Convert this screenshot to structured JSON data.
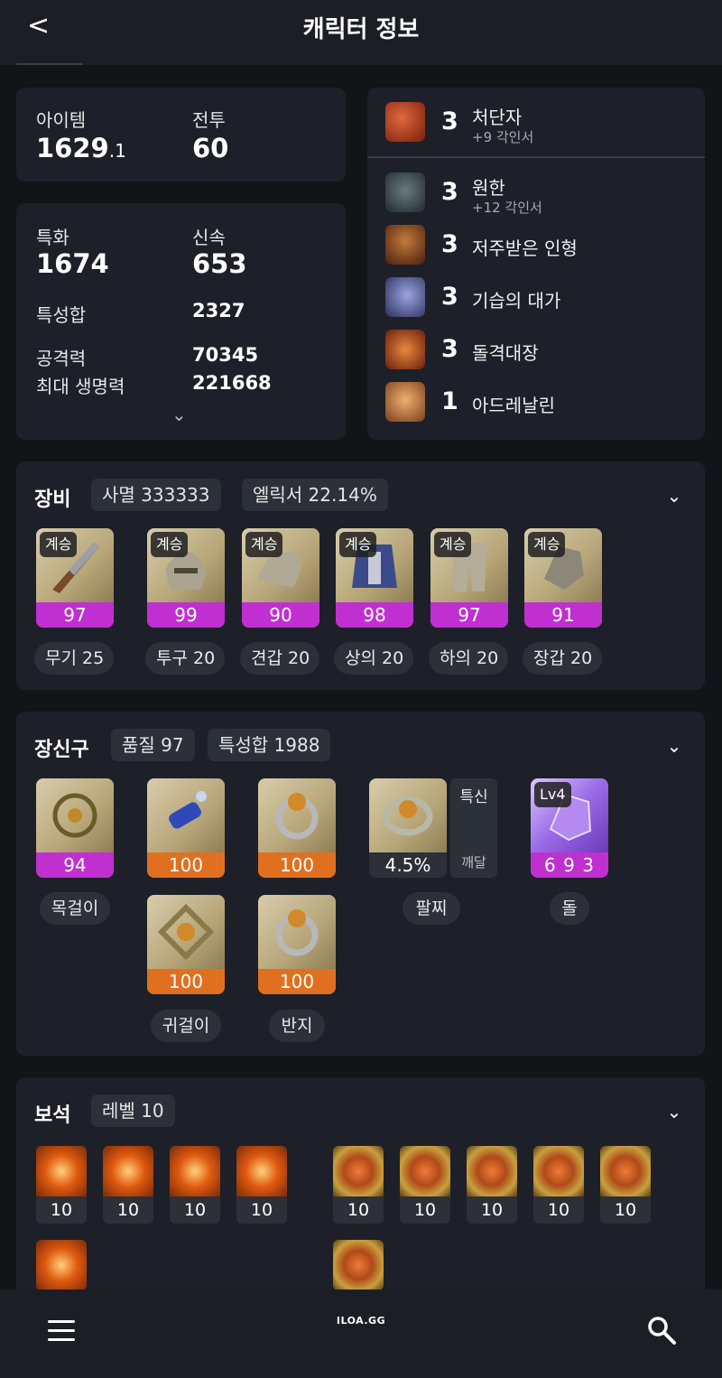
{
  "header": {
    "back": "<",
    "title": "캐릭터 정보"
  },
  "stats_top": {
    "item_label": "아이템",
    "item_value": "1629",
    "item_decimal": ".1",
    "combat_label": "전투",
    "combat_value": "60"
  },
  "stats": {
    "spec_label": "특화",
    "spec_value": "1674",
    "swift_label": "신속",
    "swift_value": "653",
    "total_label": "특성합",
    "total_value": "2327",
    "atk_label": "공격력",
    "atk_value": "70345",
    "hp_label": "최대 생명력",
    "hp_value": "221668",
    "expand": "⌄"
  },
  "engravings": [
    {
      "level": "3",
      "name": "처단자",
      "sub": "+9 각인서",
      "icon_color": "#b83a1c"
    },
    {
      "level": "3",
      "name": "원한",
      "sub": "+12 각인서",
      "icon_color": "#3a4d4f"
    },
    {
      "level": "3",
      "name": "저주받은 인형",
      "sub": "",
      "icon_color": "#8a4a1a"
    },
    {
      "level": "3",
      "name": "기습의 대가",
      "sub": "",
      "icon_color": "#3b3f78"
    },
    {
      "level": "3",
      "name": "돌격대장",
      "sub": "",
      "icon_color": "#b5441c"
    },
    {
      "level": "1",
      "name": "아드레날린",
      "sub": "",
      "icon_color": "#c8743a"
    }
  ],
  "equipment": {
    "title": "장비",
    "pill1": "사멸 333333",
    "pill2": "엘릭서 22.14%",
    "items": [
      {
        "tag": "계승",
        "quality": "97",
        "chip": "무기 25"
      },
      {
        "tag": "계승",
        "quality": "99",
        "chip": "투구 20"
      },
      {
        "tag": "계승",
        "quality": "90",
        "chip": "견갑 20"
      },
      {
        "tag": "계승",
        "quality": "98",
        "chip": "상의 20"
      },
      {
        "tag": "계승",
        "quality": "97",
        "chip": "하의 20"
      },
      {
        "tag": "계승",
        "quality": "91",
        "chip": "장갑 20"
      }
    ]
  },
  "accessories": {
    "title": "장신구",
    "pill1": "품질 97",
    "pill2": "특성합 1988",
    "necklace": {
      "quality": "94",
      "chip": "목걸이"
    },
    "earring1": {
      "quality": "100"
    },
    "earring2": {
      "quality": "100",
      "chip": "귀걸이"
    },
    "ring1": {
      "quality": "100"
    },
    "ring2": {
      "quality": "100",
      "chip": "반지"
    },
    "bracelet": {
      "value": "4.5%",
      "stat1": "특신",
      "stat2": "깨달",
      "chip": "팔찌"
    },
    "stone": {
      "tag": "Lv4",
      "value": "6 9 3",
      "chip": "돌"
    }
  },
  "gems": {
    "title": "보석",
    "pill1": "레벨 10",
    "row1_left": [
      "10",
      "10",
      "10",
      "10"
    ],
    "row1_right": [
      "10",
      "10",
      "10",
      "10",
      "10"
    ]
  },
  "bottom_nav": {
    "brand": "ILOA.GG"
  },
  "colors": {
    "quality_purple": "#c030d0",
    "quality_orange": "#e07020",
    "bg": "#121418",
    "card": "#1d2028"
  }
}
